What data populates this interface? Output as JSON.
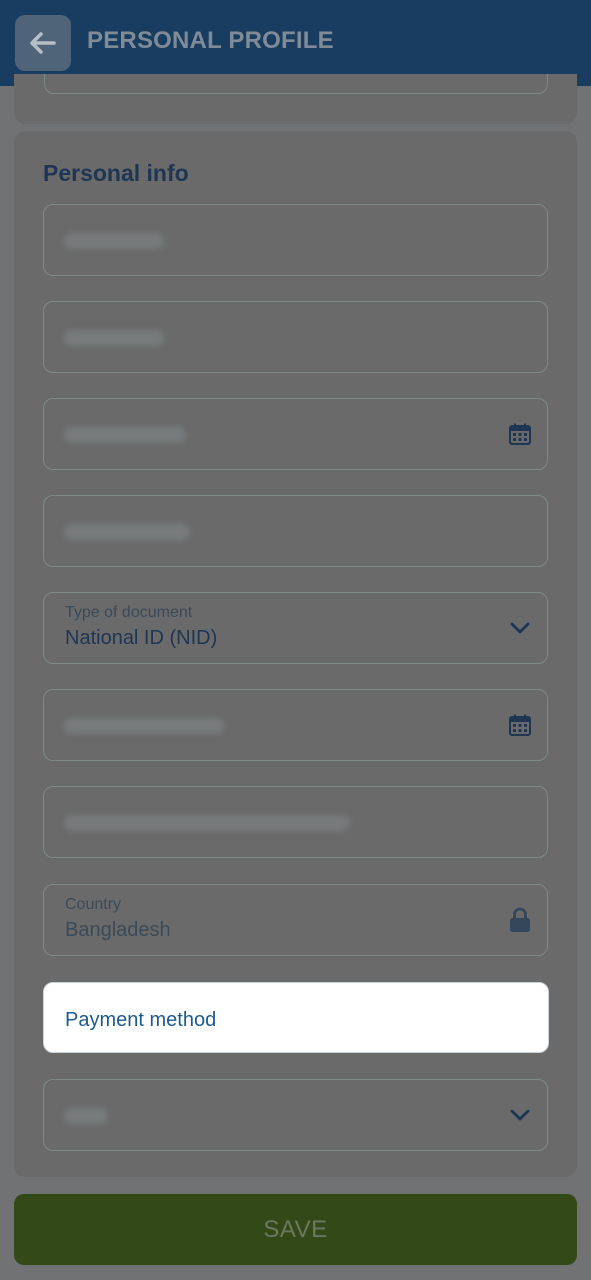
{
  "header": {
    "title": "PERSONAL PROFILE",
    "back_icon": "arrow-left-icon"
  },
  "section": {
    "title": "Personal info"
  },
  "fields": {
    "document_type": {
      "label": "Type of document",
      "value": "National ID (NID)"
    },
    "country": {
      "label": "Country",
      "value": "Bangladesh"
    }
  },
  "payment": {
    "label": "Payment method"
  },
  "footer": {
    "save_label": "SAVE"
  },
  "colors": {
    "header_bg": "#193c61",
    "overlay": "#707273",
    "save_bg": "#344918",
    "accent_text": "#1d5a8e"
  }
}
